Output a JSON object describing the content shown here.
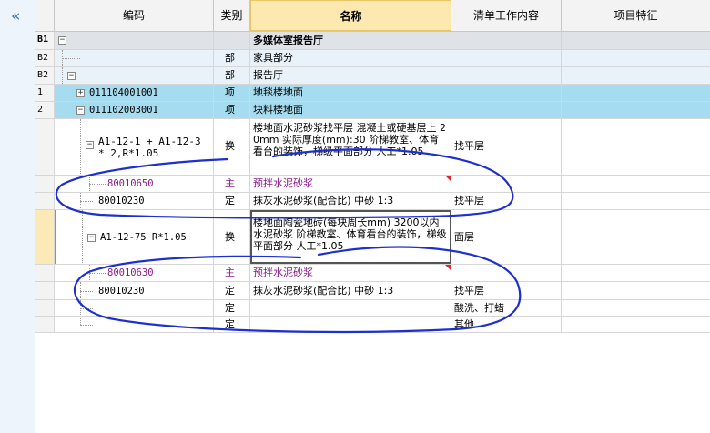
{
  "sidebar": {
    "collapse_icon": "«"
  },
  "header": {
    "col_code": "编码",
    "col_type": "类别",
    "col_name": "名称",
    "col_work": "清单工作内容",
    "col_feature": "项目特征"
  },
  "rows": [
    {
      "label": "B1",
      "code": "",
      "type": "",
      "name": "多媒体室报告厅",
      "work": ""
    },
    {
      "label": "B2",
      "code": "",
      "type": "部",
      "name": "家具部分",
      "work": ""
    },
    {
      "label": "B2",
      "code": "",
      "type": "部",
      "name": "报告厅",
      "work": ""
    },
    {
      "label": "1",
      "code": "011104001001",
      "type": "项",
      "name": "地毯楼地面",
      "work": ""
    },
    {
      "label": "2",
      "code": "011102003001",
      "type": "项",
      "name": "块料楼地面",
      "work": ""
    },
    {
      "label": "",
      "code": "A1-12-1 + A1-12-3 * 2,R*1.05",
      "type": "换",
      "name": "楼地面水泥砂浆找平层 混凝土或硬基层上 20mm 实际厚度(mm):30 阶梯教室、体育看台的装饰，梯级平面部分 人工*1.05",
      "work": "找平层"
    },
    {
      "label": "",
      "code": "80010650",
      "type": "主",
      "name": "预拌水泥砂浆",
      "work": ""
    },
    {
      "label": "",
      "code": "80010230",
      "type": "定",
      "name": "抹灰水泥砂浆(配合比) 中砂 1:3",
      "work": "找平层"
    },
    {
      "label": "",
      "code": "A1-12-75 R*1.05",
      "type": "换",
      "name": "楼地面陶瓷地砖(每块周长mm) 3200以内 水泥砂浆 阶梯教室、体育看台的装饰，梯级平面部分 人工*1.05",
      "work": "面层"
    },
    {
      "label": "",
      "code": "80010630",
      "type": "主",
      "name": "预拌水泥砂浆",
      "work": ""
    },
    {
      "label": "",
      "code": "80010230",
      "type": "定",
      "name": "抹灰水泥砂浆(配合比) 中砂 1:3",
      "work": "找平层"
    },
    {
      "label": "",
      "code": "",
      "type": "定",
      "name": "",
      "work": "酸洗、打蜡"
    },
    {
      "label": "",
      "code": "",
      "type": "定",
      "name": "",
      "work": "其他"
    }
  ],
  "colors": {
    "highlight_row": "#a6dcef",
    "active_header": "#fde9b0",
    "ink": "#1e2fd0",
    "purple_text": "#8b1a8b"
  }
}
